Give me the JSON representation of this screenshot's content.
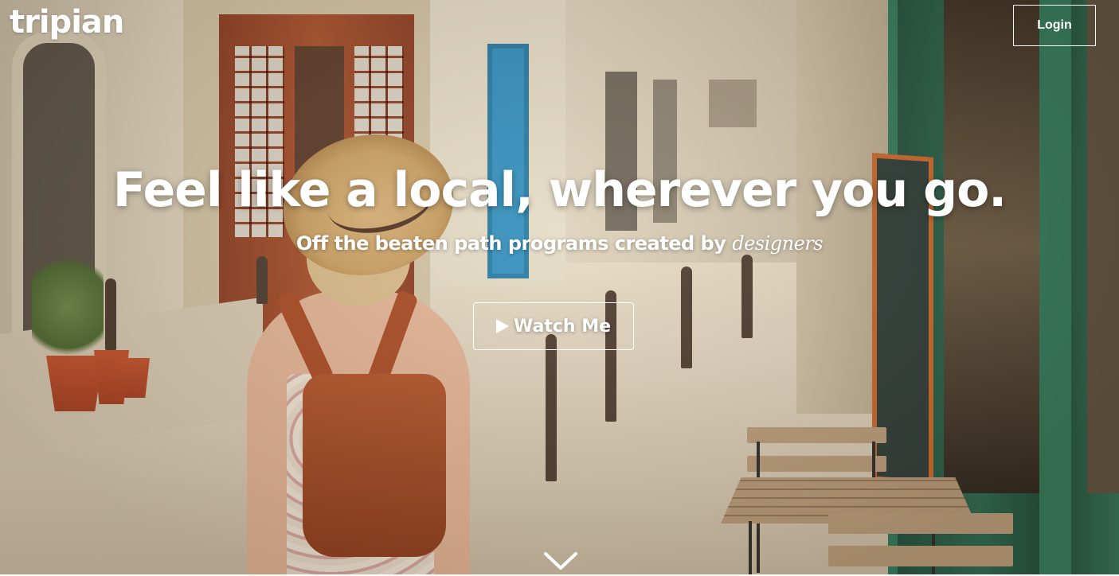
{
  "brand": {
    "logo_text": "tripian"
  },
  "header": {
    "login_label": "Login"
  },
  "hero": {
    "headline": "Feel like a local, wherever you go.",
    "subheadline_prefix": "Off the beaten path programs created by ",
    "subheadline_emphasis": "designers",
    "watch_label": "Watch Me"
  },
  "icons": {
    "play": "play-icon",
    "scroll": "chevron-down-icon"
  },
  "colors": {
    "text": "#ffffff",
    "button_border": "#ffffff"
  }
}
